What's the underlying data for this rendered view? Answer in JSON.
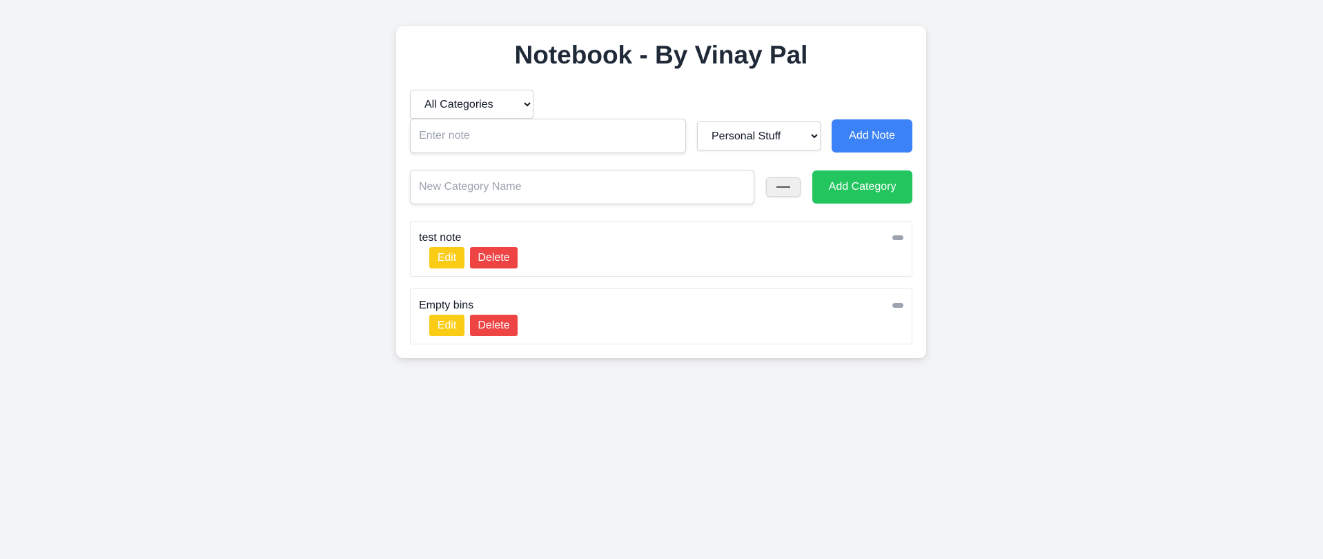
{
  "app": {
    "title": "Notebook - By Vinay Pal"
  },
  "filter": {
    "selected": "All Categories",
    "options": [
      "All Categories"
    ]
  },
  "note_form": {
    "placeholder": "Enter note",
    "value": "",
    "category_selected": "Personal Stuff",
    "category_options": [
      "Personal Stuff"
    ],
    "add_label": "Add Note"
  },
  "category_form": {
    "placeholder": "New Category Name",
    "value": "",
    "add_label": "Add Category"
  },
  "notes": [
    {
      "text": "test note",
      "edit_label": "Edit",
      "delete_label": "Delete",
      "tag_icon": "category-tag-icon"
    },
    {
      "text": "Empty bins",
      "edit_label": "Edit",
      "delete_label": "Delete",
      "tag_icon": "category-tag-icon"
    }
  ],
  "colors": {
    "background": "#f3f4f6",
    "title": "#1f2937",
    "add_note": "#3b82f6",
    "add_category": "#22c55e",
    "edit": "#facc15",
    "delete": "#ef4444",
    "tag": "#9ca3af"
  }
}
